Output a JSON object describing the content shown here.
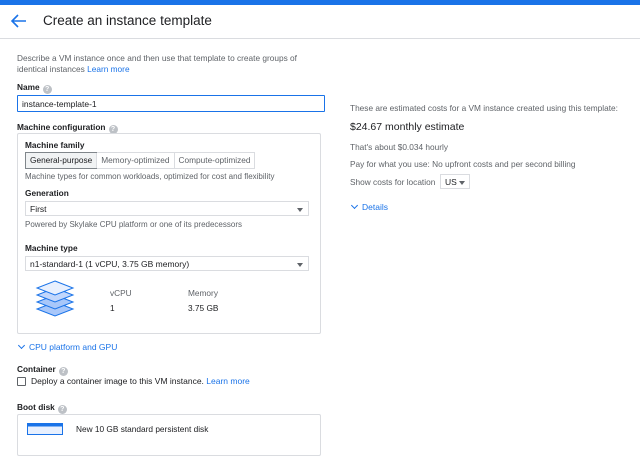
{
  "header": {
    "title": "Create an instance template"
  },
  "intro": {
    "text": "Describe a VM instance once and then use that template to create groups of identical instances",
    "learn_more": "Learn more"
  },
  "name": {
    "label": "Name",
    "value": "instance-template-1"
  },
  "machine_config": {
    "label": "Machine configuration",
    "family_label": "Machine family",
    "tabs": [
      "General-purpose",
      "Memory-optimized",
      "Compute-optimized"
    ],
    "family_desc": "Machine types for common workloads, optimized for cost and flexibility",
    "generation_label": "Generation",
    "generation_value": "First",
    "generation_desc": "Powered by Skylake CPU platform or one of its predecessors",
    "type_label": "Machine type",
    "type_value": "n1-standard-1 (1 vCPU, 3.75 GB memory)",
    "vcpu_label": "vCPU",
    "vcpu_value": "1",
    "memory_label": "Memory",
    "memory_value": "3.75 GB"
  },
  "cpu_platform_link": "CPU platform and GPU",
  "container": {
    "label": "Container",
    "checkbox_text": "Deploy a container image to this VM instance.",
    "learn_more": "Learn more"
  },
  "boot_disk": {
    "label": "Boot disk",
    "disk_text": "New 10 GB standard persistent disk"
  },
  "pricing": {
    "intro": "These are estimated costs for a VM instance created using this template:",
    "monthly": "$24.67 monthly estimate",
    "hourly": "That's about $0.034 hourly",
    "billing": "Pay for what you use: No upfront costs and per second billing",
    "location_label": "Show costs for location",
    "location_value": "US",
    "details": "Details"
  },
  "colors": {
    "accent": "#1a73e8",
    "border": "#dadce0",
    "muted": "#5f6368"
  }
}
